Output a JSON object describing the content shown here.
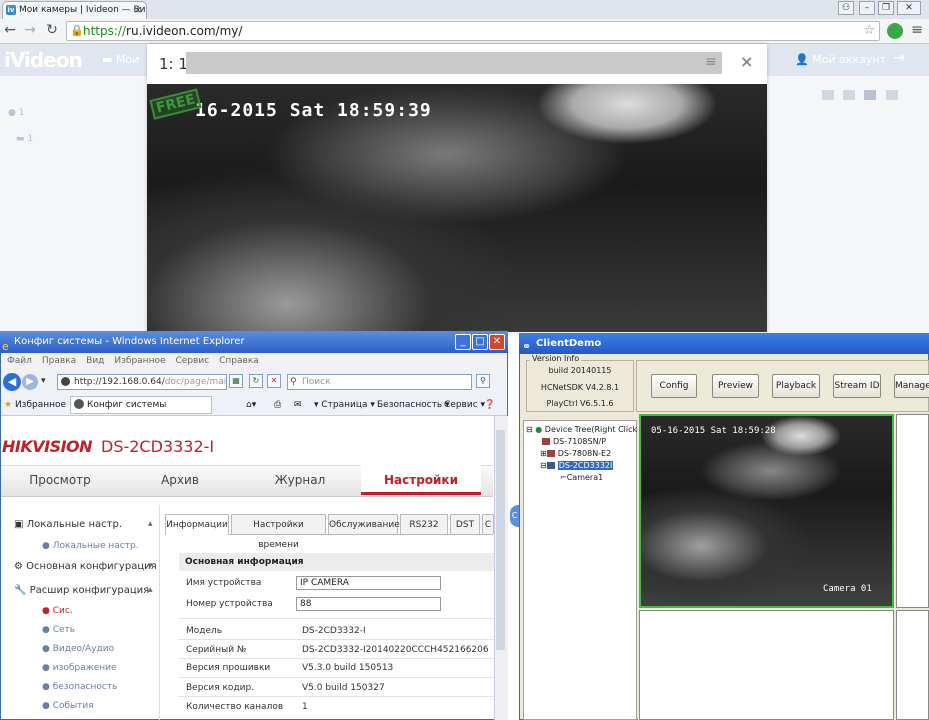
{
  "chrome": {
    "tab_title": "Мои камеры | Ivideon — Ви...",
    "tab_favicon": "iv",
    "url_scheme": "https://",
    "url_rest": "ru.ivideon.com/my/"
  },
  "ivideon": {
    "logo": "iVideon",
    "nav_my_cameras": "Мои",
    "nav_account": "Мой аккаунт",
    "list_item_1": "1",
    "list_item_2": "1",
    "modal": {
      "title": "1: 1",
      "osd_text": "16-2015 Sat 18:59:39",
      "watermark": "FREE"
    }
  },
  "ie": {
    "window_title": "Конфиг системы - Windows Internet Explorer",
    "menu": [
      "Файл",
      "Правка",
      "Вид",
      "Избранное",
      "Сервис",
      "Справка"
    ],
    "address_host": "http://192.168.0.64/",
    "address_path": "doc/page/main.a",
    "search_placeholder": "Поиск",
    "favorites_label": "Избранное",
    "tab_title": "Конфиг системы",
    "cmd_page": "Страница",
    "cmd_security": "Безопасность",
    "cmd_service": "Сервис",
    "hik": {
      "logo": "HIKVISION",
      "model": "DS-2CD3332-I",
      "tabs": [
        "Просмотр",
        "Архив",
        "Журнал",
        "Настройки"
      ],
      "left_nav": {
        "local": "Локальные настр.",
        "local_sub": "Локальные настр.",
        "basic": "Основная конфигурация",
        "extended": "Расшир конфигурация",
        "subs": [
          "Сис.",
          "Сеть",
          "Видео/Аудио",
          "изображение",
          "безопасность",
          "События"
        ]
      },
      "subtabs": [
        "Информации",
        "Настройки времени",
        "Обслуживание",
        "RS232",
        "DST",
        "С"
      ],
      "section_title": "Основная информация",
      "device_name_label": "Имя устройства",
      "device_name_value": "IP CAMERA",
      "device_number_label": "Номер устройства",
      "device_number_value": "88",
      "rows": [
        {
          "label": "Модель",
          "value": "DS-2CD3332-I"
        },
        {
          "label": "Серийный №",
          "value": "DS-2CD3332-I20140220CCCH452166206"
        },
        {
          "label": "Версия прошивки",
          "value": "V5.3.0 build 150513"
        },
        {
          "label": "Версия кодир.",
          "value": "V5.0 build 150327"
        },
        {
          "label": "Количество каналов",
          "value": "1"
        }
      ]
    }
  },
  "clientdemo": {
    "window_title": "ClientDemo",
    "version_info_label": "Version Info",
    "build": "build 20140115",
    "sdk": "HCNetSDK V4.2.8.1",
    "playctrl": "PlayCtrl V6.5.1.6",
    "buttons": [
      "Config",
      "Preview",
      "Playback",
      "Stream ID",
      "Managem"
    ],
    "tree_root": "Device Tree(Right Click",
    "tree_nodes": [
      "DS-7108SN/P",
      "DS-7808N-E2",
      "DS-2CD3332I"
    ],
    "tree_camera": "Camera1",
    "osd_text": "05-16-2015 Sat 18:59:28",
    "camera_label": "Camera 01"
  }
}
